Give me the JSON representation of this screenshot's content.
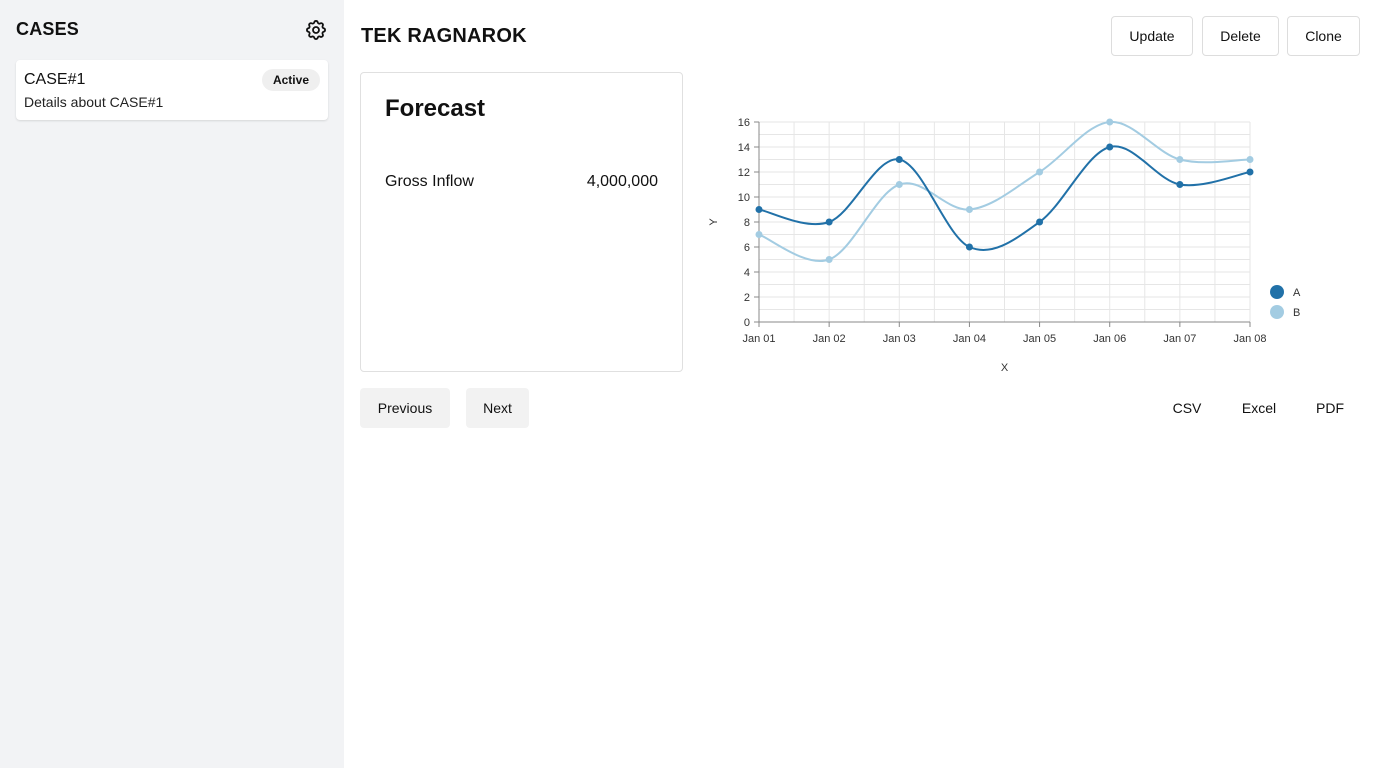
{
  "sidebar": {
    "title": "CASES",
    "settings_icon": "gear-icon",
    "cases": [
      {
        "name": "CASE#1",
        "status": "Active",
        "details": "Details about CASE#1"
      }
    ]
  },
  "header": {
    "title": "TEK RAGNAROK",
    "update_label": "Update",
    "delete_label": "Delete",
    "clone_label": "Clone"
  },
  "forecast": {
    "title": "Forecast",
    "metric_label": "Gross Inflow",
    "metric_value": "4,000,000"
  },
  "pager": {
    "previous_label": "Previous",
    "next_label": "Next"
  },
  "export": {
    "csv_label": "CSV",
    "excel_label": "Excel",
    "pdf_label": "PDF"
  },
  "chart_data": {
    "type": "line",
    "title": "",
    "xlabel": "X",
    "ylabel": "Y",
    "categories": [
      "Jan 01",
      "Jan 02",
      "Jan 03",
      "Jan 04",
      "Jan 05",
      "Jan 06",
      "Jan 07",
      "Jan 08"
    ],
    "ylim": [
      0,
      16
    ],
    "yticks": [
      0,
      2,
      4,
      6,
      8,
      10,
      12,
      14,
      16
    ],
    "grid": true,
    "legend": "right",
    "series": [
      {
        "name": "A",
        "color": "#2171a8",
        "values": [
          9,
          8,
          13,
          6,
          8,
          14,
          11,
          12
        ]
      },
      {
        "name": "B",
        "color": "#a3cce2",
        "values": [
          7,
          5,
          11,
          9,
          12,
          16,
          13,
          13
        ]
      }
    ]
  }
}
